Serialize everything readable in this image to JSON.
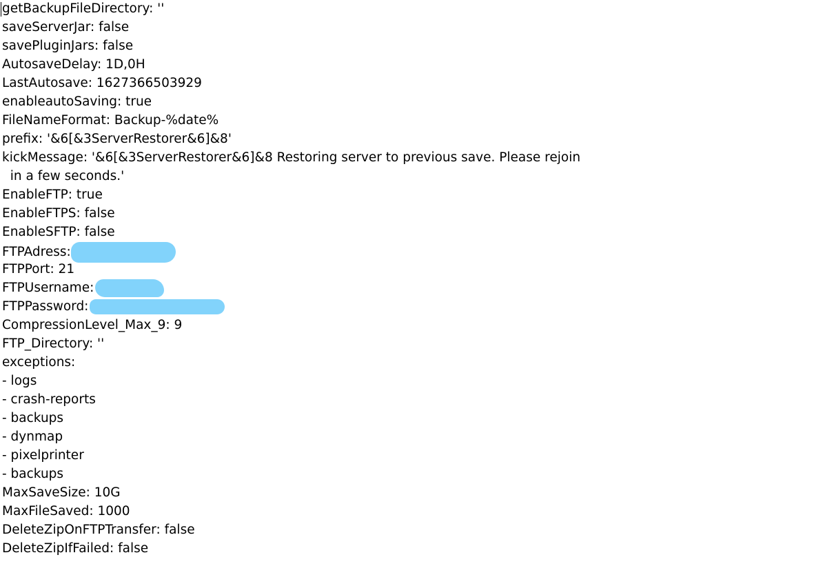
{
  "lines": [
    "getBackupFileDirectory: ''",
    "saveServerJar: false",
    "savePluginJars: false",
    "AutosaveDelay: 1D,0H",
    "LastAutosave: 1627366503929",
    "enableautoSaving: true",
    "FileNameFormat: Backup-%date%",
    "prefix: '&6[&3ServerRestorer&6]&8'",
    "kickMessage: '&6[&3ServerRestorer&6]&8 Restoring server to previous save. Please rejoin",
    "  in a few seconds.'",
    "EnableFTP: true",
    "EnableFTPS: false",
    "EnableSFTP: false",
    "FTPAdress:",
    "FTPPort: 21",
    "FTPUsername:",
    "FTPPassword:",
    "CompressionLevel_Max_9: 9",
    "FTP_Directory: ''",
    "exceptions:",
    "- logs",
    "- crash-reports",
    "- backups",
    "- dynmap",
    "- pixelprinter",
    "- backups",
    "MaxSaveSize: 10G",
    "MaxFileSaved: 1000",
    "DeleteZipOnFTPTransfer: false",
    "DeleteZipIfFailed: false"
  ],
  "redaction_color": "#82d3fb"
}
